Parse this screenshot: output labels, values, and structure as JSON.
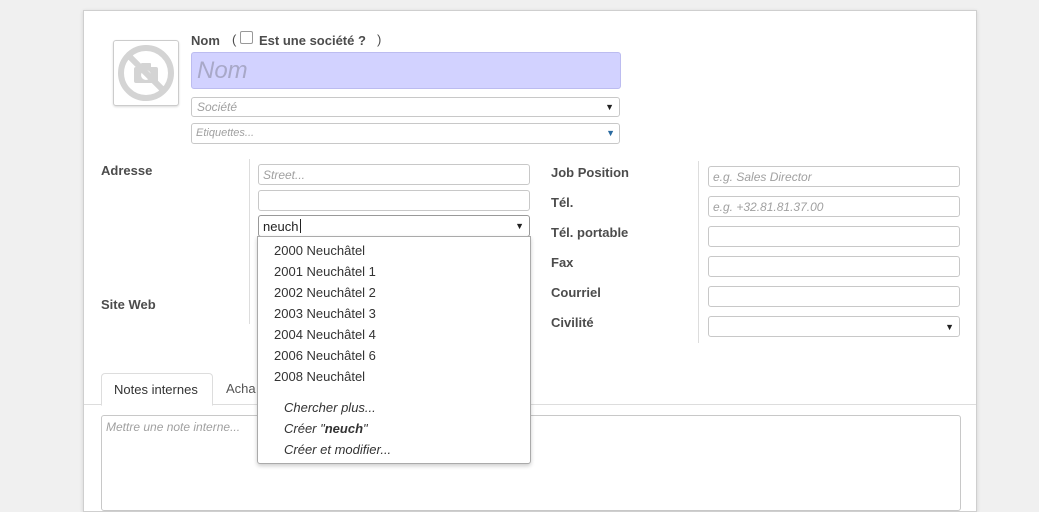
{
  "header": {
    "name_label": "Nom",
    "paren_open": "(",
    "paren_close": ")",
    "is_company_label": "Est une société ?",
    "is_company_checked": false,
    "name_placeholder": "Nom",
    "company_placeholder": "Société",
    "tags_placeholder": "Etiquettes..."
  },
  "address": {
    "label": "Adresse",
    "street_placeholder": "Street...",
    "street2_value": "",
    "city_value": "neuch",
    "website_label": "Site Web"
  },
  "dropdown": {
    "items": [
      "2000 Neuchâtel",
      "2001 Neuchâtel 1",
      "2002 Neuchâtel 2",
      "2003 Neuchâtel 3",
      "2004 Neuchâtel 4",
      "2006 Neuchâtel 6",
      "2008 Neuchâtel"
    ],
    "search_more": "Chercher plus...",
    "create_prefix": "Créer \"",
    "create_term": "neuch",
    "create_suffix": "\"",
    "create_edit": "Créer et modifier..."
  },
  "contact": {
    "job_label": "Job Position",
    "job_placeholder": "e.g. Sales Director",
    "phone_label": "Tél.",
    "phone_placeholder": "e.g. +32.81.81.37.00",
    "mobile_label": "Tél. portable",
    "fax_label": "Fax",
    "email_label": "Courriel",
    "title_label": "Civilité"
  },
  "tabs": {
    "notes_label": "Notes internes",
    "purchase_label": "Acha",
    "notes_placeholder": "Mettre une note interne..."
  }
}
